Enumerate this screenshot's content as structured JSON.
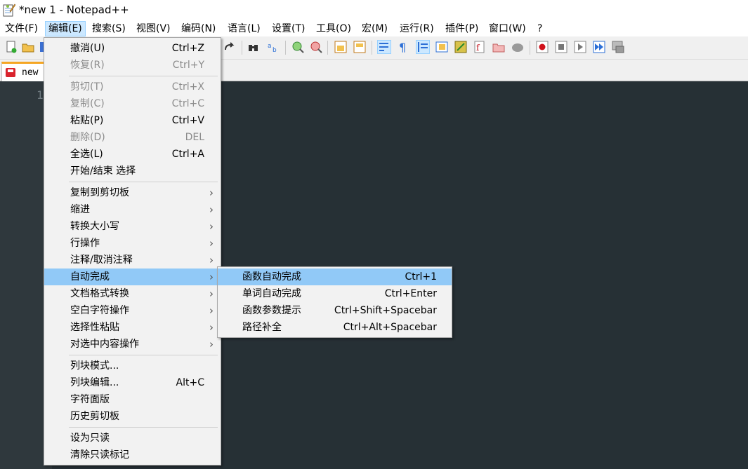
{
  "window": {
    "title": "*new 1 - Notepad++"
  },
  "menubar": {
    "items": [
      "文件(F)",
      "编辑(E)",
      "搜索(S)",
      "视图(V)",
      "编码(N)",
      "语言(L)",
      "设置(T)",
      "工具(O)",
      "宏(M)",
      "运行(R)",
      "插件(P)",
      "窗口(W)",
      "?"
    ],
    "active": "编辑(E)"
  },
  "toolbar": {
    "icons": [
      "new-file",
      "open-file",
      "save-file",
      "redo",
      "find",
      "replace",
      "zoom-in",
      "zoom-out",
      "sync-vertical",
      "sync-horizontal",
      "word-wrap",
      "show-all-chars",
      "indent-guide",
      "doc-map",
      "function-list",
      "folder-workspace",
      "monitor",
      "record-macro",
      "stop-record",
      "play-macro",
      "run-macro-multiple",
      "save-macro"
    ],
    "colors": {
      "record": "#d0101a",
      "accent": "#2c6fd6"
    }
  },
  "tab": {
    "label": "new"
  },
  "editor": {
    "line_numbers": [
      "1"
    ],
    "background": "#263035"
  },
  "edit_menu": {
    "items": [
      {
        "label": "撤消(U)",
        "shortcut": "Ctrl+Z",
        "disabled": false
      },
      {
        "label": "恢复(R)",
        "shortcut": "Ctrl+Y",
        "disabled": true
      },
      {
        "label": "剪切(T)",
        "shortcut": "Ctrl+X",
        "disabled": true
      },
      {
        "label": "复制(C)",
        "shortcut": "Ctrl+C",
        "disabled": true
      },
      {
        "label": "粘贴(P)",
        "shortcut": "Ctrl+V",
        "disabled": false
      },
      {
        "label": "删除(D)",
        "shortcut": "DEL",
        "disabled": true
      },
      {
        "label": "全选(L)",
        "shortcut": "Ctrl+A",
        "disabled": false
      },
      {
        "label": "开始/结束 选择",
        "shortcut": "",
        "disabled": false
      },
      {
        "label": "复制到剪切板",
        "submenu": true
      },
      {
        "label": "缩进",
        "submenu": true
      },
      {
        "label": "转换大小写",
        "submenu": true
      },
      {
        "label": "行操作",
        "submenu": true
      },
      {
        "label": "注释/取消注释",
        "submenu": true
      },
      {
        "label": "自动完成",
        "submenu": true,
        "highlighted": true
      },
      {
        "label": "文档格式转换",
        "submenu": true
      },
      {
        "label": "空白字符操作",
        "submenu": true
      },
      {
        "label": "选择性粘贴",
        "submenu": true
      },
      {
        "label": "对选中内容操作",
        "submenu": true
      },
      {
        "label": "列块模式...",
        "shortcut": ""
      },
      {
        "label": "列块编辑...",
        "shortcut": "Alt+C"
      },
      {
        "label": "字符面版",
        "shortcut": ""
      },
      {
        "label": "历史剪切板",
        "shortcut": ""
      },
      {
        "label": "设为只读",
        "shortcut": ""
      },
      {
        "label": "清除只读标记",
        "shortcut": ""
      }
    ]
  },
  "autocomplete_submenu": {
    "items": [
      {
        "label": "函数自动完成",
        "shortcut": "Ctrl+1",
        "highlighted": true
      },
      {
        "label": "单词自动完成",
        "shortcut": "Ctrl+Enter"
      },
      {
        "label": "函数参数提示",
        "shortcut": "Ctrl+Shift+Spacebar"
      },
      {
        "label": "路径补全",
        "shortcut": "Ctrl+Alt+Spacebar"
      }
    ]
  }
}
